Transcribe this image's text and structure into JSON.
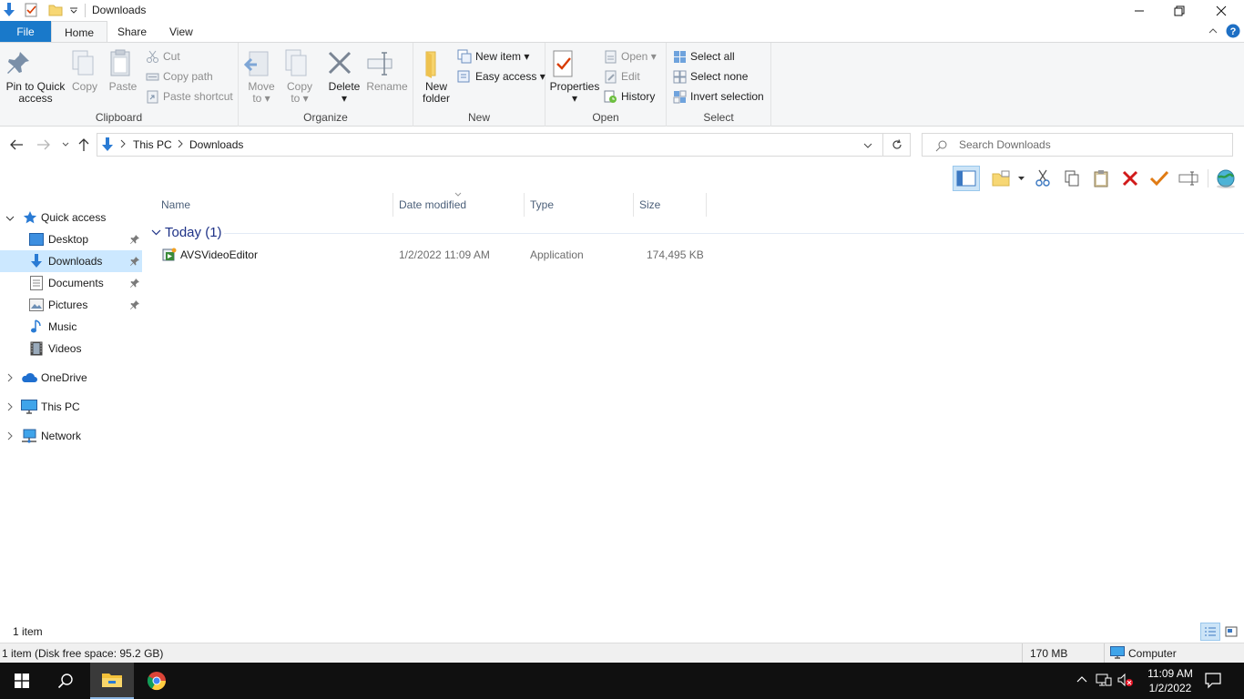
{
  "window": {
    "title": "Downloads"
  },
  "tabs": [
    {
      "label": "File"
    },
    {
      "label": "Home"
    },
    {
      "label": "Share"
    },
    {
      "label": "View"
    }
  ],
  "ribbon": {
    "clipboard": {
      "label": "Clipboard",
      "pin_label_1": "Pin to Quick",
      "pin_label_2": "access",
      "copy": "Copy",
      "paste": "Paste",
      "cut": "Cut",
      "copy_path": "Copy path",
      "paste_shortcut": "Paste shortcut"
    },
    "organize": {
      "label": "Organize",
      "move_1": "Move",
      "move_2": "to",
      "copy_1": "Copy",
      "copy_2": "to",
      "delete": "Delete",
      "rename": "Rename"
    },
    "new": {
      "label": "New",
      "new_folder_1": "New",
      "new_folder_2": "folder",
      "new_item": "New item",
      "easy_access": "Easy access"
    },
    "open": {
      "label": "Open",
      "properties": "Properties",
      "open": "Open",
      "edit": "Edit",
      "history": "History"
    },
    "select": {
      "label": "Select",
      "select_all": "Select all",
      "select_none": "Select none",
      "invert": "Invert selection"
    }
  },
  "address": {
    "crumbs": [
      "This PC",
      "Downloads"
    ],
    "search_placeholder": "Search Downloads"
  },
  "nav": {
    "quick_access": "Quick access",
    "desktop": "Desktop",
    "downloads": "Downloads",
    "documents": "Documents",
    "pictures": "Pictures",
    "music": "Music",
    "videos": "Videos",
    "onedrive": "OneDrive",
    "this_pc": "This PC",
    "network": "Network"
  },
  "columns": {
    "name": "Name",
    "date": "Date modified",
    "type": "Type",
    "size": "Size"
  },
  "group": {
    "label": "Today (1)"
  },
  "files": [
    {
      "name": "AVSVideoEditor",
      "date": "1/2/2022 11:09 AM",
      "type": "Application",
      "size": "174,495 KB"
    }
  ],
  "status": {
    "item_count": "1 item",
    "detail": "1 item (Disk free space: 95.2 GB)",
    "size": "170 MB",
    "location": "Computer"
  },
  "taskbar": {
    "time": "11:09 AM",
    "date": "1/2/2022"
  },
  "colors": {
    "accent": "#1979ca",
    "selection": "#cce8ff",
    "taskbar": "#101010"
  }
}
